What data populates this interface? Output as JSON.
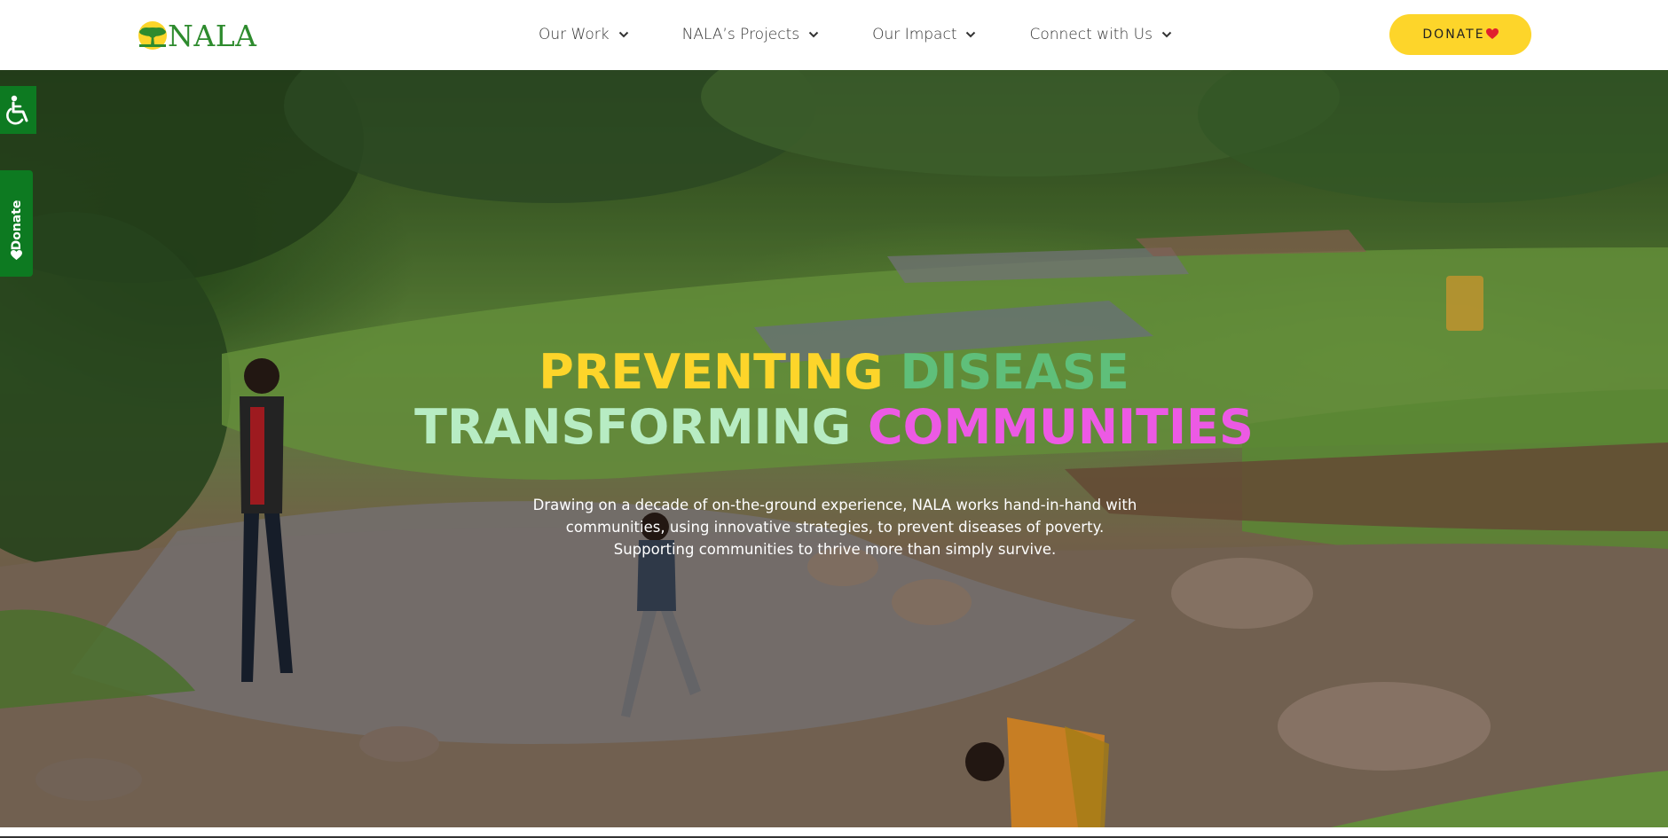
{
  "brand": {
    "name": "NALA",
    "logo_icon": "acacia-tree-icon",
    "brand_green": "#2e8b2e",
    "accent_yellow": "#fdd52a"
  },
  "nav": {
    "items": [
      {
        "label": "Our Work",
        "icon": "chevron-down-icon"
      },
      {
        "label": "NALA’s Projects",
        "icon": "chevron-down-icon"
      },
      {
        "label": "Our Impact",
        "icon": "chevron-down-icon"
      },
      {
        "label": "Connect with Us",
        "icon": "chevron-down-icon"
      }
    ]
  },
  "header": {
    "donate_label": "DONATE",
    "donate_icon": "heart-icon",
    "donate_bg": "#fdd52a",
    "heart_color": "#e0202e"
  },
  "hero": {
    "headline_line1": [
      "PREVENTING",
      "DISEASE"
    ],
    "headline_line2": [
      "TRANSFORMING",
      "COMMUNITIES"
    ],
    "headline_colors": {
      "yellow": "#fdd52a",
      "green": "#5fbf7a",
      "mint": "#b7ecc3",
      "pink": "#ec5ae4"
    },
    "description": "Drawing on a decade of on-the-ground experience, NALA works hand-in-hand with communities, using innovative strategies, to prevent diseases of poverty. Supporting communities to thrive more than simply survive.",
    "background_image": "children crossing a stream in a green rural landscape"
  },
  "side_widgets": {
    "accessibility_icon": "wheelchair-accessibility-icon",
    "donate_tab_label": "Donate",
    "donate_tab_icon": "heart-icon",
    "widget_green": "#0d7a21"
  }
}
